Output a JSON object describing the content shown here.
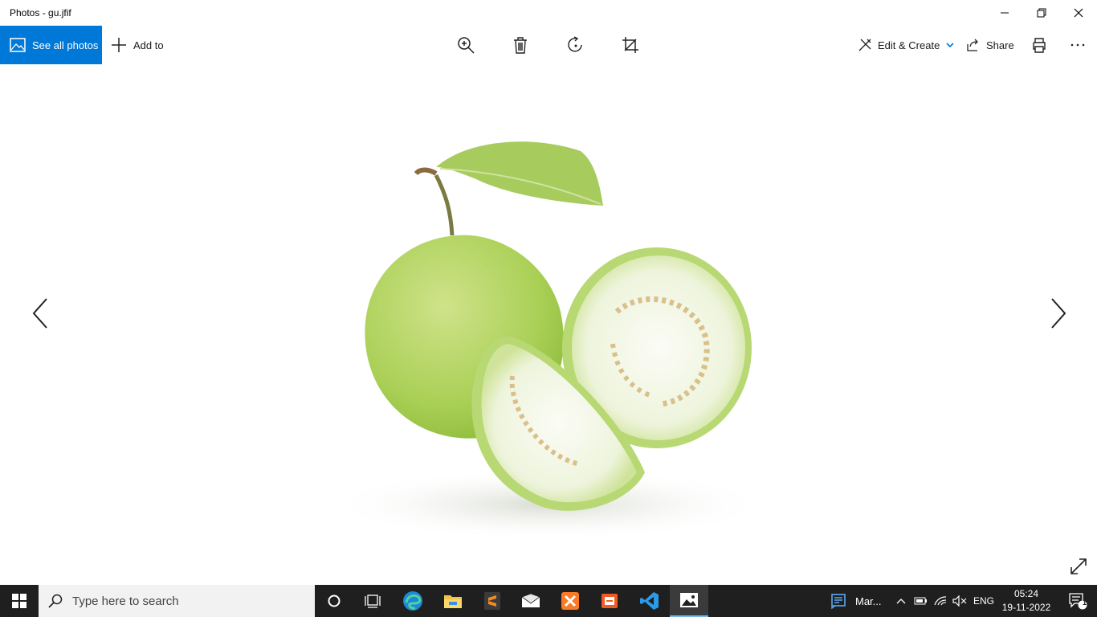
{
  "window": {
    "title": "Photos - gu.jfif",
    "minimize_icon": "minimize-icon",
    "restore_icon": "restore-icon",
    "close_icon": "close-icon"
  },
  "toolbar": {
    "see_all_label": "See all photos",
    "add_to_label": "Add to",
    "edit_create_label": "Edit & Create",
    "share_label": "Share",
    "icons": [
      "zoom-icon",
      "delete-icon",
      "rotate-icon",
      "crop-icon",
      "print-icon",
      "more-icon"
    ]
  },
  "viewer": {
    "image_subject": "guava fruit with leaf and cut halves",
    "colors": {
      "accent": "#0078d7",
      "fruit": "#b8d86a",
      "flesh": "#f4f7ec",
      "seeds": "#d9c08a"
    }
  },
  "taskbar": {
    "search_placeholder": "Type here to search",
    "apps": [
      "cortana-icon",
      "task-view-icon",
      "edge-icon",
      "file-explorer-icon",
      "sublime-icon",
      "mail-icon",
      "xampp-icon",
      "app-icon",
      "vscode-icon",
      "photos-icon"
    ],
    "news_label": "Mar...",
    "language": "ENG",
    "time": "05:24",
    "date": "19-11-2022",
    "notification_count": "1"
  }
}
